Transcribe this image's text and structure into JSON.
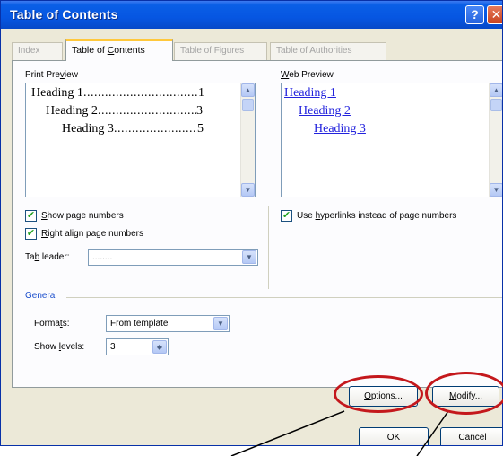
{
  "window": {
    "title": "Table of Contents",
    "help_glyph": "?",
    "close_glyph": "✕"
  },
  "tabs": [
    {
      "label": "Index",
      "active": false
    },
    {
      "label": "Table of Contents",
      "active": true
    },
    {
      "label": "Table of Figures",
      "active": false
    },
    {
      "label": "Table of Authorities",
      "active": false
    }
  ],
  "print_preview": {
    "label": "Print Preview",
    "entries": [
      {
        "text": "Heading 1",
        "page": "1"
      },
      {
        "text": "Heading 2",
        "page": "3"
      },
      {
        "text": "Heading 3",
        "page": "5"
      }
    ]
  },
  "web_preview": {
    "label": "Web Preview",
    "links": [
      "Heading 1",
      "Heading 2",
      "Heading 3"
    ]
  },
  "options": {
    "show_page_numbers": {
      "label": "Show page numbers",
      "checked": true
    },
    "right_align": {
      "label": "Right align page numbers",
      "checked": true
    },
    "use_hyperlinks": {
      "label": "Use hyperlinks instead of page numbers",
      "checked": true
    },
    "tab_leader": {
      "label": "Tab leader:",
      "value": "........"
    }
  },
  "general": {
    "label": "General",
    "formats": {
      "label": "Formats:",
      "value": "From template"
    },
    "show_levels": {
      "label": "Show levels:",
      "value": "3"
    }
  },
  "buttons": {
    "options": "Options...",
    "modify": "Modify...",
    "ok": "OK",
    "cancel": "Cancel"
  },
  "icons": {
    "scroll_up": "▲",
    "scroll_down": "▼",
    "dropdown": "▼",
    "spin": "◆",
    "check": "✔"
  },
  "colors": {
    "accent_tab": "#ffc83c",
    "annotation": "#c4181c",
    "hyperlink": "#2222dd"
  }
}
